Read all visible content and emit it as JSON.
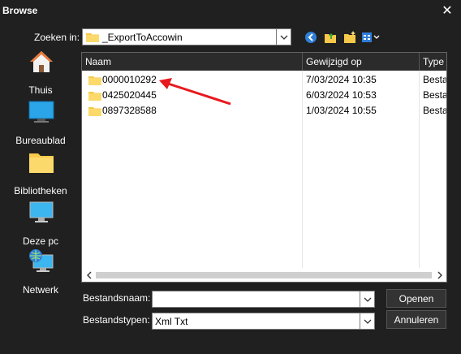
{
  "window": {
    "title": "Browse"
  },
  "lookin": {
    "label": "Zoeken in:",
    "value": "_ExportToAccowin"
  },
  "toolbar": {
    "icons": [
      "back-icon",
      "up-folder-icon",
      "new-folder-icon",
      "view-menu-icon"
    ]
  },
  "places": [
    {
      "label": "Thuis",
      "icon": "home-icon"
    },
    {
      "label": "Bureaublad",
      "icon": "desktop-icon"
    },
    {
      "label": "Bibliotheken",
      "icon": "libraries-icon"
    },
    {
      "label": "Deze pc",
      "icon": "computer-icon"
    },
    {
      "label": "Netwerk",
      "icon": "network-icon"
    }
  ],
  "columns": [
    "Naam",
    "Gewijzigd op",
    "Type"
  ],
  "files": [
    {
      "name": "0000010292",
      "modified": "7/03/2024 10:35",
      "type": "Besta"
    },
    {
      "name": "0425020445",
      "modified": "6/03/2024 10:53",
      "type": "Besta"
    },
    {
      "name": "0897328588",
      "modified": "1/03/2024 10:55",
      "type": "Besta"
    }
  ],
  "filename": {
    "label": "Bestandsnaam:",
    "value": ""
  },
  "filetype": {
    "label": "Bestandstypen:",
    "value": "Xml Txt"
  },
  "buttons": {
    "open": "Openen",
    "cancel": "Annuleren"
  },
  "colors": {
    "annotation_arrow": "#e8191e",
    "folder": "#f6c94a"
  }
}
